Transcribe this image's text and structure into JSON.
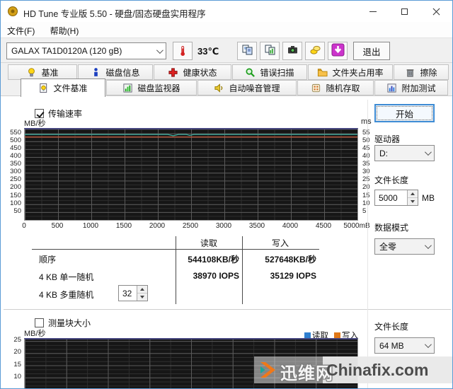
{
  "window": {
    "title": "HD Tune 专业版 5.50 - 硬盘/固态硬盘实用程序"
  },
  "menu": {
    "items": [
      {
        "id": "file",
        "label": "文件(F)"
      },
      {
        "id": "help",
        "label": "帮助(H)"
      }
    ]
  },
  "toolbar": {
    "device_select": "GALAX TA1D0120A (120 gB)",
    "temperature": "33℃",
    "buttons": [
      {
        "id": "copy-text"
      },
      {
        "id": "copy-image"
      },
      {
        "id": "screenshot"
      },
      {
        "id": "donate"
      },
      {
        "id": "download"
      }
    ],
    "exit_label": "退出"
  },
  "tabs": {
    "row1": [
      {
        "id": "benchmark",
        "label": "基准"
      },
      {
        "id": "disk-info",
        "label": "磁盘信息"
      },
      {
        "id": "health",
        "label": "健康状态"
      },
      {
        "id": "error-scan",
        "label": "错误扫描"
      },
      {
        "id": "folder-usage",
        "label": "文件夹占用率"
      },
      {
        "id": "erase",
        "label": "擦除"
      }
    ],
    "row2": [
      {
        "id": "file-benchmark",
        "label": "文件基准",
        "active": true
      },
      {
        "id": "disk-monitor",
        "label": "磁盘监视器"
      },
      {
        "id": "aam",
        "label": "自动噪音管理"
      },
      {
        "id": "random-access",
        "label": "随机存取"
      },
      {
        "id": "extra-tests",
        "label": "附加测试"
      }
    ]
  },
  "panel": {
    "transfer_rate_label": "传输速率",
    "start_button": "开始",
    "drive_label": "驱动器",
    "drive_value": "D:",
    "file_length_label": "文件长度",
    "file_length_value": "5000",
    "file_length_unit": "MB",
    "data_mode_label": "数据模式",
    "data_mode_value": "全零",
    "results": {
      "read_header": "读取",
      "write_header": "写入",
      "rows": [
        {
          "label": "顺序",
          "read": "544108KB/秒",
          "write": "527648KB/秒"
        },
        {
          "label": "4 KB 单一随机",
          "read": "38970 IOPS",
          "write": "35129 IOPS"
        },
        {
          "label": "4 KB 多重随机",
          "queue_depth": "32"
        }
      ]
    },
    "block_size_label": "测量块大小",
    "bottom_file_length_label": "文件长度",
    "bottom_file_length_value": "64 MB",
    "legend": [
      {
        "label": "读取",
        "color": "#2f7fd0"
      },
      {
        "label": "写入",
        "color": "#e07818"
      }
    ]
  },
  "watermark": {
    "site_cn": "迅维网",
    "site_en": "Chinafix.com"
  },
  "chart_data": [
    {
      "name": "file-benchmark-transfer-rate",
      "type": "line",
      "ylabel": "MB/秒",
      "ylabel_right": "ms",
      "xlim": [
        0,
        5000
      ],
      "ylim": [
        0,
        575
      ],
      "x_minor": 250,
      "x_major": 500,
      "y_minor": 25,
      "y_major": 50,
      "yticks": [
        550,
        500,
        450,
        400,
        350,
        300,
        250,
        200,
        150,
        100,
        50
      ],
      "right_yticks": [
        55,
        50,
        45,
        40,
        35,
        30,
        25,
        20,
        15,
        10,
        5
      ],
      "right_scale": 10,
      "xticks": [
        {
          "v": 0,
          "label": "0"
        },
        {
          "v": 500,
          "label": "500"
        },
        {
          "v": 1000,
          "label": "1000"
        },
        {
          "v": 1500,
          "label": "1500"
        },
        {
          "v": 2000,
          "label": "2000"
        },
        {
          "v": 2500,
          "label": "2500"
        },
        {
          "v": 3000,
          "label": "3000"
        },
        {
          "v": 3500,
          "label": "3500"
        },
        {
          "v": 4000,
          "label": "4000"
        },
        {
          "v": 4500,
          "label": "4500"
        },
        {
          "v": 5000,
          "label": "5000mB"
        }
      ],
      "series": [
        {
          "name": "读取",
          "color": "#3fae9e",
          "points": [
            [
              0,
              543
            ],
            [
              2150,
              543
            ],
            [
              2230,
              535
            ],
            [
              2310,
              543
            ],
            [
              2430,
              543
            ],
            [
              2480,
              537
            ],
            [
              2540,
              543
            ],
            [
              5000,
              543
            ]
          ]
        },
        {
          "name": "写入",
          "color": "#c05a3c",
          "points": [
            [
              0,
              527
            ],
            [
              5000,
              527
            ]
          ]
        }
      ],
      "summary": {
        "sequential_read": "544108KB/秒",
        "sequential_write": "527648KB/秒",
        "random_4k_read_iops": 38970,
        "random_4k_write_iops": 35129,
        "queue_depth": 32
      }
    },
    {
      "name": "block-size-chart",
      "type": "line",
      "ylabel": "MB/秒",
      "xlim": [
        0,
        16
      ],
      "ylim": [
        5.3,
        25.6
      ],
      "x_minor": 1,
      "x_major": 2,
      "y_minor": 1.6667,
      "y_major": 5,
      "yticks": [
        25,
        20,
        15,
        10
      ],
      "series": []
    }
  ]
}
